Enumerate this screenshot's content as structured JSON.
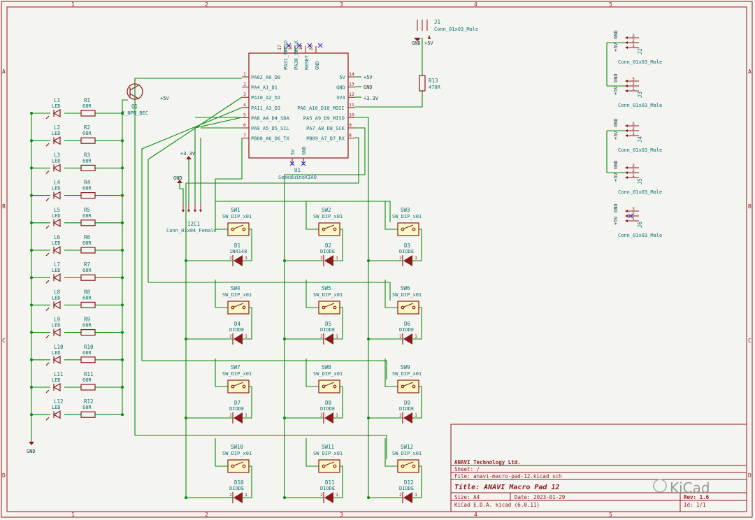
{
  "sheet": {
    "columns": [
      "1",
      "2",
      "3",
      "4",
      "5"
    ],
    "rows": [
      "A",
      "B",
      "C",
      "D"
    ]
  },
  "mcu": {
    "ref": "U1",
    "value": "SeeeduinoXIAO",
    "left_pins": [
      {
        "num": "1",
        "name": "PA02_A0_D0"
      },
      {
        "num": "2",
        "name": "PA4_A1_D1"
      },
      {
        "num": "3",
        "name": "PA10_A2_D2"
      },
      {
        "num": "4",
        "name": "PA11_A3_D3"
      },
      {
        "num": "5",
        "name": "PA8_A4_D4_SDA"
      },
      {
        "num": "6",
        "name": "PA9_A5_D5_SCL"
      },
      {
        "num": "7",
        "name": "PB08_A6_D6_TX"
      }
    ],
    "right_pins": [
      {
        "num": "14",
        "name": "5V"
      },
      {
        "num": "13",
        "name": "GND"
      },
      {
        "num": "12",
        "name": "3V3"
      },
      {
        "num": "11",
        "name": "PA6_A10_D10_MOSI"
      },
      {
        "num": "10",
        "name": "PA5_A9_D9_MISO"
      },
      {
        "num": "9",
        "name": "PA7_A8_D8_SCK"
      },
      {
        "num": "8",
        "name": "PB09_A7_D7_RX"
      }
    ],
    "top_pins": [
      {
        "num": "17",
        "name": "PA31_SWDIO"
      },
      {
        "num": "18",
        "name": "PA30_SWCLK"
      },
      {
        "num": "19",
        "name": "RESET"
      },
      {
        "num": "20",
        "name": "GND"
      }
    ],
    "bottom_pins": [
      {
        "num": "15",
        "name": "5V"
      },
      {
        "num": "16",
        "name": "GND"
      }
    ],
    "power_labels": [
      "+5V",
      "GND",
      "+3.3V"
    ]
  },
  "transistor": {
    "ref": "Q1",
    "value": "2_NPN_BEC",
    "supply": "+5V"
  },
  "leds": [
    {
      "led": "L1",
      "res": "R1"
    },
    {
      "led": "L2",
      "res": "R2"
    },
    {
      "led": "L3",
      "res": "R3"
    },
    {
      "led": "L4",
      "res": "R4"
    },
    {
      "led": "L5",
      "res": "R5"
    },
    {
      "led": "L6",
      "res": "R6"
    },
    {
      "led": "L7",
      "res": "R7"
    },
    {
      "led": "L8",
      "res": "R8"
    },
    {
      "led": "L9",
      "res": "R9"
    },
    {
      "led": "L10",
      "res": "R10"
    },
    {
      "led": "L11",
      "res": "R11"
    },
    {
      "led": "L12",
      "res": "R12"
    }
  ],
  "led_value": "LED",
  "res_value": "68R",
  "gnd_label": "GND",
  "j1": {
    "ref": "J1",
    "value": "Conn_01x03_Male",
    "pins": [
      "GND",
      "+5V"
    ]
  },
  "r13": {
    "ref": "R13",
    "value": "470R"
  },
  "i2c": {
    "ref": "I2C1",
    "value": "Conn_01x04_Female",
    "labels": [
      "+3.3V",
      "GND"
    ]
  },
  "switches": [
    {
      "sw": "SW1",
      "d": "D1",
      "dval": "1N4148"
    },
    {
      "sw": "SW2",
      "d": "D2",
      "dval": "DIODE"
    },
    {
      "sw": "SW3",
      "d": "D3",
      "dval": "DIODE"
    },
    {
      "sw": "SW4",
      "d": "D4",
      "dval": "DIODE"
    },
    {
      "sw": "SW5",
      "d": "D5",
      "dval": "DIODE"
    },
    {
      "sw": "SW6",
      "d": "D6",
      "dval": "DIODE"
    },
    {
      "sw": "SW7",
      "d": "D7",
      "dval": "DIODE"
    },
    {
      "sw": "SW8",
      "d": "D8",
      "dval": "DIODE"
    },
    {
      "sw": "SW9",
      "d": "D9",
      "dval": "DIODE"
    },
    {
      "sw": "SW10",
      "d": "D10",
      "dval": "DIODE"
    },
    {
      "sw": "SW11",
      "d": "D11",
      "dval": "DIODE"
    },
    {
      "sw": "SW12",
      "d": "D12",
      "dval": "DIODE"
    }
  ],
  "sw_value": "SW_DIP_x01",
  "connectors": [
    {
      "ref": "J2",
      "value": "Conn_01x03_Male"
    },
    {
      "ref": "J3",
      "value": "Conn_01x03_Male"
    },
    {
      "ref": "J4",
      "value": "Conn_01x03_Male"
    },
    {
      "ref": "J5",
      "value": "Conn_01x03_Male"
    },
    {
      "ref": "J6",
      "value": "Conn_01x03_Male"
    }
  ],
  "conn_labels": [
    "+5V",
    "GND"
  ],
  "title_block": {
    "company": "ANAVI Technology Ltd.",
    "sheet": "Sheet: /",
    "file": "File: anavi-macro-pad-12.kicad_sch",
    "title": "Title: ANAVI Macro Pad 12",
    "size": "Size: A4",
    "date": "Date: 2023-01-29",
    "rev": "Rev: 1.6",
    "tool": "KiCad E.D.A.  kicad (6.0.11)",
    "id": "Id: 1/1"
  },
  "watermark": {
    "text": "KiCad",
    "sub": "KiCad"
  }
}
